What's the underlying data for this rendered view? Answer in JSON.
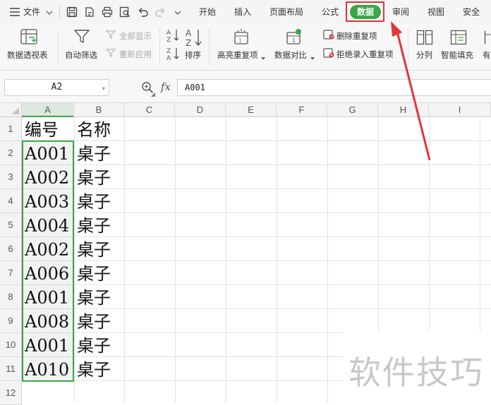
{
  "menu": {
    "file_label": "文件",
    "tabs": [
      "开始",
      "插入",
      "页面布局",
      "公式",
      "数据",
      "审阅",
      "视图",
      "安全"
    ],
    "active_tab": "数据"
  },
  "ribbon": {
    "pivot": "数据透视表",
    "autofilter": "自动筛选",
    "show_all": "全部显示",
    "reapply": "重新应用",
    "sort": "排序",
    "highlight_dup": "高亮重复项",
    "compare": "数据对比",
    "remove_dup": "删除重复项",
    "reject_dup": "拒绝录入重复项",
    "split_col": "分列",
    "smart_fill": "智能填充",
    "truncated": "有"
  },
  "formula_bar": {
    "name_box": "A2",
    "fx": "fx",
    "value": "A001"
  },
  "grid": {
    "columns": [
      "A",
      "B",
      "C",
      "D",
      "E",
      "F",
      "G",
      "H",
      "I"
    ],
    "selected_column": "A",
    "rows": [
      "1",
      "2",
      "3",
      "4",
      "5",
      "6",
      "7",
      "8",
      "9",
      "10",
      "11",
      "12"
    ],
    "cells": [
      [
        "编号",
        "名称"
      ],
      [
        "A001",
        "桌子"
      ],
      [
        "A002",
        "桌子"
      ],
      [
        "A003",
        "桌子"
      ],
      [
        "A004",
        "桌子"
      ],
      [
        "A002",
        "桌子"
      ],
      [
        "A006",
        "桌子"
      ],
      [
        "A001",
        "桌子"
      ],
      [
        "A008",
        "桌子"
      ],
      [
        "A001",
        "桌子"
      ],
      [
        "A010",
        "桌子"
      ]
    ]
  },
  "watermark": "软件技巧",
  "colors": {
    "accent": "#3aa648",
    "highlight_red": "#e5343a"
  }
}
